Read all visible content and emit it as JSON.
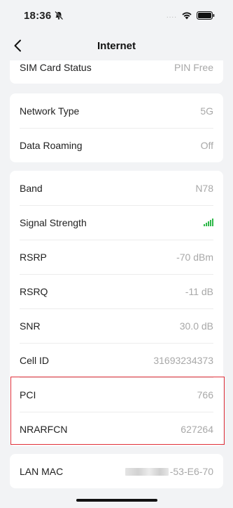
{
  "status_bar": {
    "time": "18:36",
    "dots": "....",
    "icons": [
      "bell-slash-icon",
      "wifi-icon",
      "battery-icon"
    ]
  },
  "nav": {
    "title": "Internet"
  },
  "sim": {
    "label": "SIM Card Status",
    "value": "PIN Free"
  },
  "network": [
    {
      "label": "Network Type",
      "value": "5G"
    },
    {
      "label": "Data Roaming",
      "value": "Off"
    }
  ],
  "cell": [
    {
      "label": "Band",
      "value": "N78"
    },
    {
      "label": "Signal Strength",
      "value": ""
    },
    {
      "label": "RSRP",
      "value": "-70 dBm"
    },
    {
      "label": "RSRQ",
      "value": "-11 dB"
    },
    {
      "label": "SNR",
      "value": "30.0 dB"
    },
    {
      "label": "Cell ID",
      "value": "31693234373"
    },
    {
      "label": "PCI",
      "value": "766"
    },
    {
      "label": "NRARFCN",
      "value": "627264"
    }
  ],
  "lan": {
    "label": "LAN MAC",
    "value_visible": "-53-E6-70"
  },
  "colors": {
    "signal": "#2fb84a",
    "highlight": "#e0303a"
  }
}
